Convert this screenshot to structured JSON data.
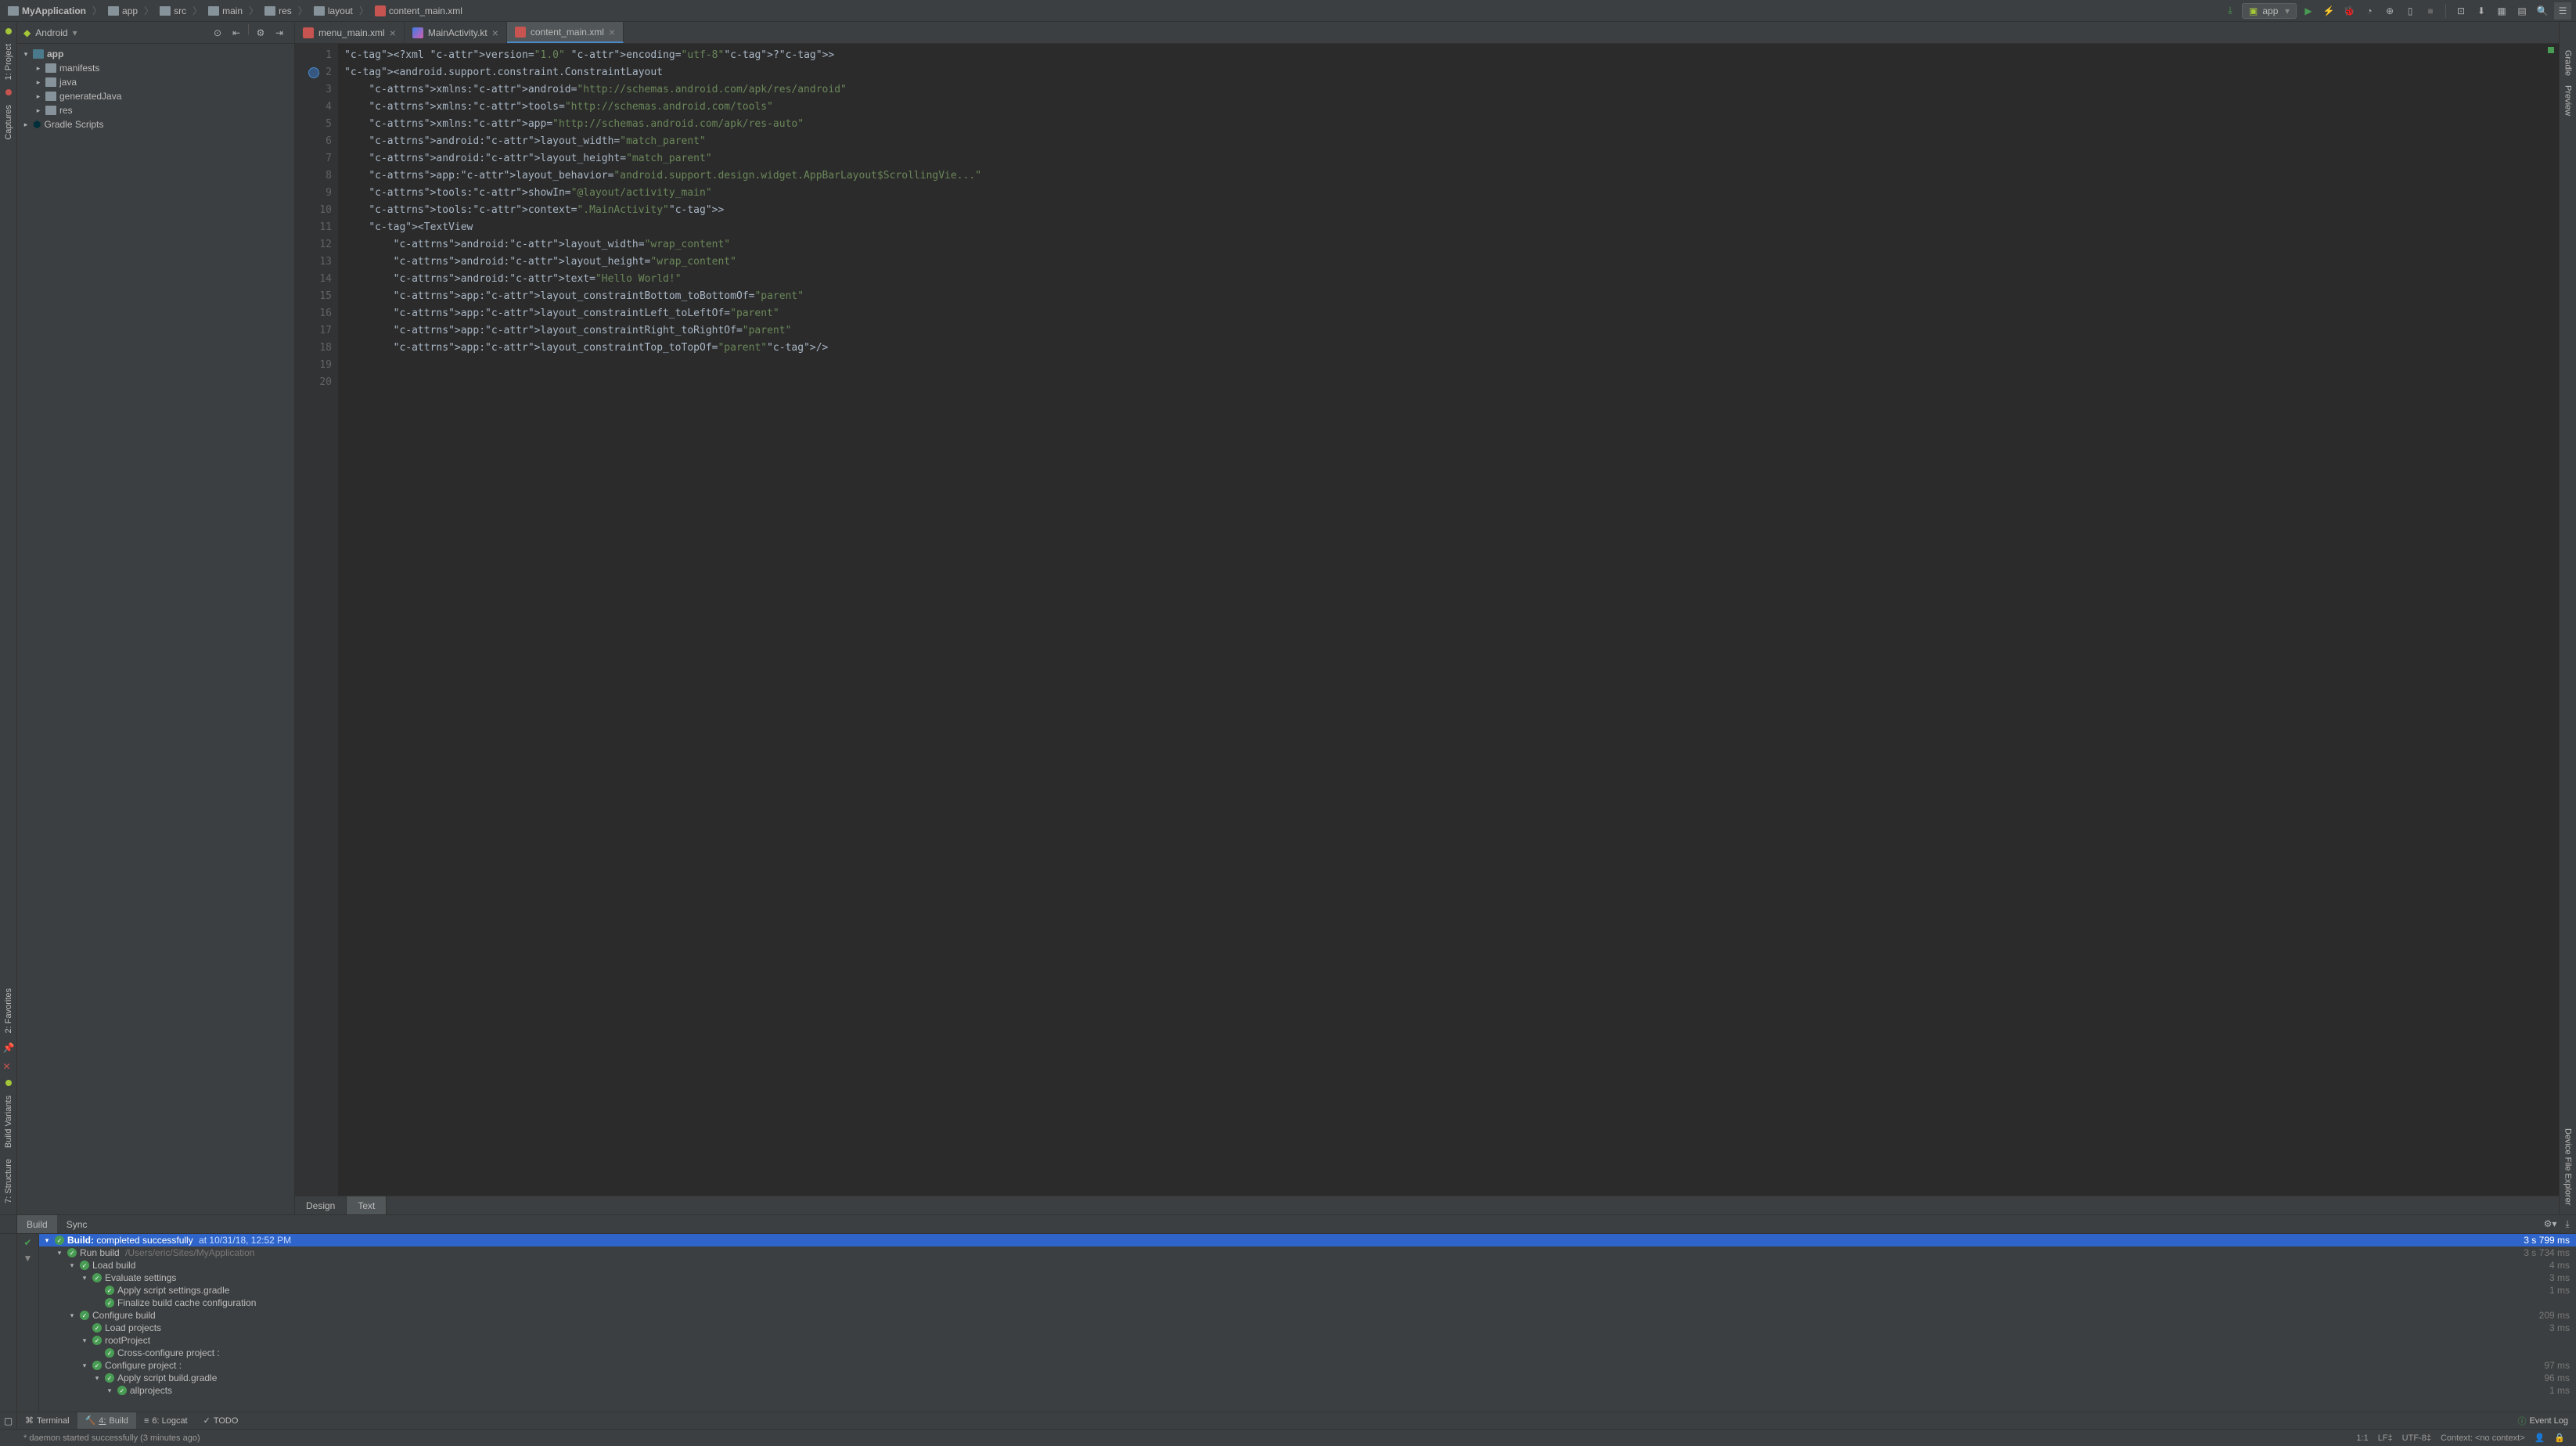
{
  "breadcrumbs": [
    "MyApplication",
    "app",
    "src",
    "main",
    "res",
    "layout",
    "content_main.xml"
  ],
  "runConfig": "app",
  "projectPanel": {
    "title": "Android",
    "tree": [
      {
        "label": "app",
        "depth": 0,
        "bold": true,
        "arrow": "▾",
        "icon": "module"
      },
      {
        "label": "manifests",
        "depth": 1,
        "arrow": "▸",
        "icon": "folder"
      },
      {
        "label": "java",
        "depth": 1,
        "arrow": "▸",
        "icon": "folder"
      },
      {
        "label": "generatedJava",
        "depth": 1,
        "arrow": "▸",
        "icon": "folder"
      },
      {
        "label": "res",
        "depth": 1,
        "arrow": "▸",
        "icon": "folder"
      },
      {
        "label": "Gradle Scripts",
        "depth": 0,
        "arrow": "▸",
        "icon": "gradle"
      }
    ]
  },
  "editorTabs": [
    {
      "label": "menu_main.xml",
      "icon": "xml",
      "active": false
    },
    {
      "label": "MainActivity.kt",
      "icon": "kt",
      "active": false
    },
    {
      "label": "content_main.xml",
      "icon": "xml",
      "active": true
    }
  ],
  "code": {
    "lines": 20,
    "content": "<?xml version=\"1.0\" encoding=\"utf-8\"?>\n<android.support.constraint.ConstraintLayout\n    xmlns:android=\"http://schemas.android.com/apk/res/android\"\n    xmlns:tools=\"http://schemas.android.com/tools\"\n    xmlns:app=\"http://schemas.android.com/apk/res-auto\"\n    android:layout_width=\"match_parent\"\n    android:layout_height=\"match_parent\"\n    app:layout_behavior=\"android.support.design.widget.AppBarLayout$ScrollingVie...\"\n    tools:showIn=\"@layout/activity_main\"\n    tools:context=\".MainActivity\">\n\n    <TextView\n        android:layout_width=\"wrap_content\"\n        android:layout_height=\"wrap_content\"\n        android:text=\"Hello World!\"\n        app:layout_constraintBottom_toBottomOf=\"parent\"\n        app:layout_constraintLeft_toLeftOf=\"parent\"\n        app:layout_constraintRight_toRightOf=\"parent\"\n        app:layout_constraintTop_toTopOf=\"parent\"/>\n"
  },
  "editorBottomTabs": [
    "Design",
    "Text"
  ],
  "editorBottomActive": "Text",
  "buildPanel": {
    "tabs": [
      "Build",
      "Sync"
    ],
    "activeTab": "Build",
    "rows": [
      {
        "depth": 0,
        "arrow": "▾",
        "label": "Build:",
        "label2": "completed successfully",
        "sublabel": "at 10/31/18, 12:52 PM",
        "timing": "3 s 799 ms",
        "selected": true,
        "strong": true
      },
      {
        "depth": 1,
        "arrow": "▾",
        "label": "Run build",
        "sublabel": "/Users/eric/Sites/MyApplication",
        "timing": "3 s 734 ms"
      },
      {
        "depth": 2,
        "arrow": "▾",
        "label": "Load build",
        "timing": "4 ms"
      },
      {
        "depth": 3,
        "arrow": "▾",
        "label": "Evaluate settings",
        "timing": "3 ms"
      },
      {
        "depth": 4,
        "arrow": "",
        "label": "Apply script settings.gradle",
        "timing": "1 ms"
      },
      {
        "depth": 4,
        "arrow": "",
        "label": "Finalize build cache configuration",
        "timing": ""
      },
      {
        "depth": 2,
        "arrow": "▾",
        "label": "Configure build",
        "timing": "209 ms"
      },
      {
        "depth": 3,
        "arrow": "",
        "label": "Load projects",
        "timing": "3 ms"
      },
      {
        "depth": 3,
        "arrow": "▾",
        "label": "rootProject",
        "timing": ""
      },
      {
        "depth": 4,
        "arrow": "",
        "label": "Cross-configure project :",
        "timing": ""
      },
      {
        "depth": 3,
        "arrow": "▾",
        "label": "Configure project :",
        "timing": "97 ms"
      },
      {
        "depth": 4,
        "arrow": "▾",
        "label": "Apply script build.gradle",
        "timing": "96 ms"
      },
      {
        "depth": 5,
        "arrow": "▾",
        "label": "allprojects",
        "timing": "1 ms"
      }
    ]
  },
  "bottomTools": [
    {
      "label": "Terminal",
      "icon": "terminal"
    },
    {
      "label": "Build",
      "icon": "build",
      "active": true,
      "underline": "4:"
    },
    {
      "label": "6: Logcat",
      "icon": "logcat"
    },
    {
      "label": "TODO",
      "icon": "todo"
    }
  ],
  "eventLog": "Event Log",
  "statusbar": {
    "message": "* daemon started successfully (3 minutes ago)",
    "pos": "1:1",
    "lineEnd": "LF",
    "encoding": "UTF-8",
    "context": "Context: <no context>"
  },
  "leftGutter": [
    "1: Project",
    "Captures",
    "2: Favorites",
    "Build Variants",
    "7: Structure"
  ],
  "rightGutter": [
    "Gradle",
    "Preview",
    "Device File Explorer"
  ]
}
